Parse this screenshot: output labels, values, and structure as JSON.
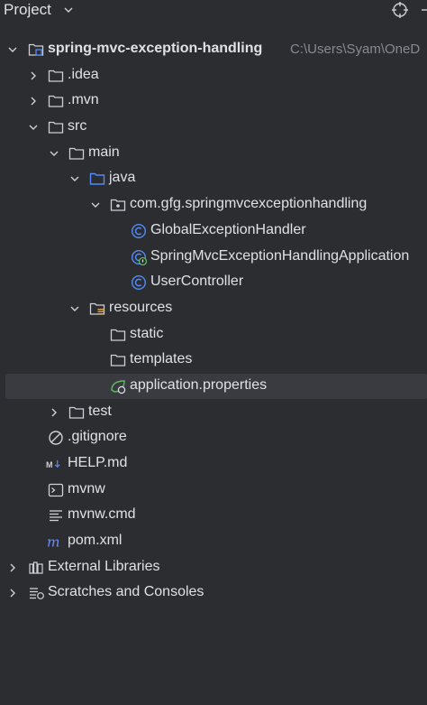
{
  "header": {
    "title": "Project",
    "chevron_icon": "chevron-down-icon",
    "target_icon": "locate-icon"
  },
  "tree": {
    "root_label": "spring-mvc-exception-handling",
    "root_path": "C:\\Users\\Syam\\OneD",
    "idea_label": ".idea",
    "mvn_label": ".mvn",
    "src_label": "src",
    "main_label": "main",
    "java_label": "java",
    "package_label": "com.gfg.springmvcexceptionhandling",
    "class1_label": "GlobalExceptionHandler",
    "class2_label": "SpringMvcExceptionHandlingApplication",
    "class3_label": "UserController",
    "resources_label": "resources",
    "static_label": "static",
    "templates_label": "templates",
    "appprops_label": "application.properties",
    "test_label": "test",
    "gitignore_label": ".gitignore",
    "help_label": "HELP.md",
    "mvnw_label": "mvnw",
    "mvnwcmd_label": "mvnw.cmd",
    "pom_label": "pom.xml",
    "extlibs_label": "External Libraries",
    "scratches_label": "Scratches and Consoles"
  },
  "colors": {
    "background": "#2b2d30",
    "selection": "#393b40",
    "text": "#dfe1e5",
    "hint": "#868a91",
    "folder_blue": "#548af7",
    "class_blue": "#548af7",
    "spring_green": "#5fb85f"
  }
}
